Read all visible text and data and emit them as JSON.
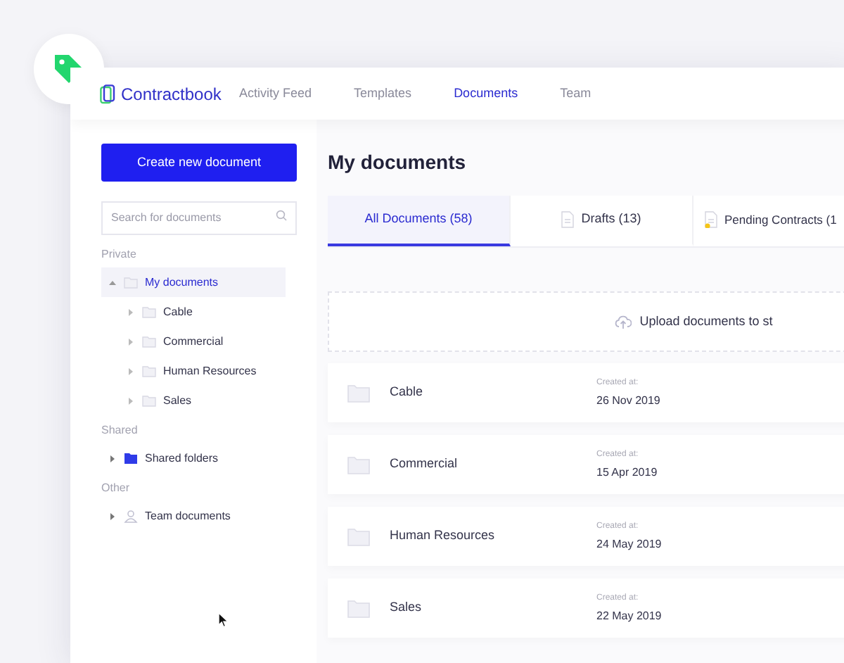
{
  "brand": {
    "name": "Contractbook"
  },
  "nav": [
    {
      "label": "Activity Feed",
      "selected": false
    },
    {
      "label": "Templates",
      "selected": false
    },
    {
      "label": "Documents",
      "selected": true
    },
    {
      "label": "Team",
      "selected": false
    }
  ],
  "sidebar": {
    "create_button": "Create new document",
    "search": {
      "placeholder": "Search for documents"
    },
    "sections": [
      {
        "title": "Private",
        "items": [
          {
            "label": "My documents",
            "kind": "folder",
            "selected": true,
            "expanded": true,
            "children": [
              {
                "label": "Cable",
                "kind": "folder",
                "selected": false,
                "expanded": false
              },
              {
                "label": "Commercial",
                "kind": "folder",
                "selected": false,
                "expanded": false
              },
              {
                "label": "Human Resources",
                "kind": "folder",
                "selected": false,
                "expanded": false
              },
              {
                "label": "Sales",
                "kind": "folder",
                "selected": false,
                "expanded": false
              }
            ]
          }
        ]
      },
      {
        "title": "Shared",
        "items": [
          {
            "label": "Shared folders",
            "kind": "folder-filled",
            "selected": false,
            "expanded": false
          }
        ]
      },
      {
        "title": "Other",
        "items": [
          {
            "label": "Team documents",
            "kind": "people",
            "selected": false,
            "expanded": false
          }
        ]
      }
    ]
  },
  "main": {
    "title": "My documents",
    "tabs": [
      {
        "label": "All Documents (58)",
        "kind": "plain",
        "selected": true
      },
      {
        "label": "Drafts (13)",
        "kind": "doc",
        "selected": false
      },
      {
        "label": "Pending Contracts (1",
        "kind": "doc-pending",
        "selected": false
      }
    ],
    "upload": "Upload documents to st",
    "folders": [
      {
        "name": "Cable",
        "created_label": "Created at:",
        "created": "26 Nov 2019"
      },
      {
        "name": "Commercial",
        "created_label": "Created at:",
        "created": "15 Apr 2019"
      },
      {
        "name": "Human Resources",
        "created_label": "Created at:",
        "created": "24 May 2019"
      },
      {
        "name": "Sales",
        "created_label": "Created at:",
        "created": "22 May 2019"
      }
    ]
  }
}
